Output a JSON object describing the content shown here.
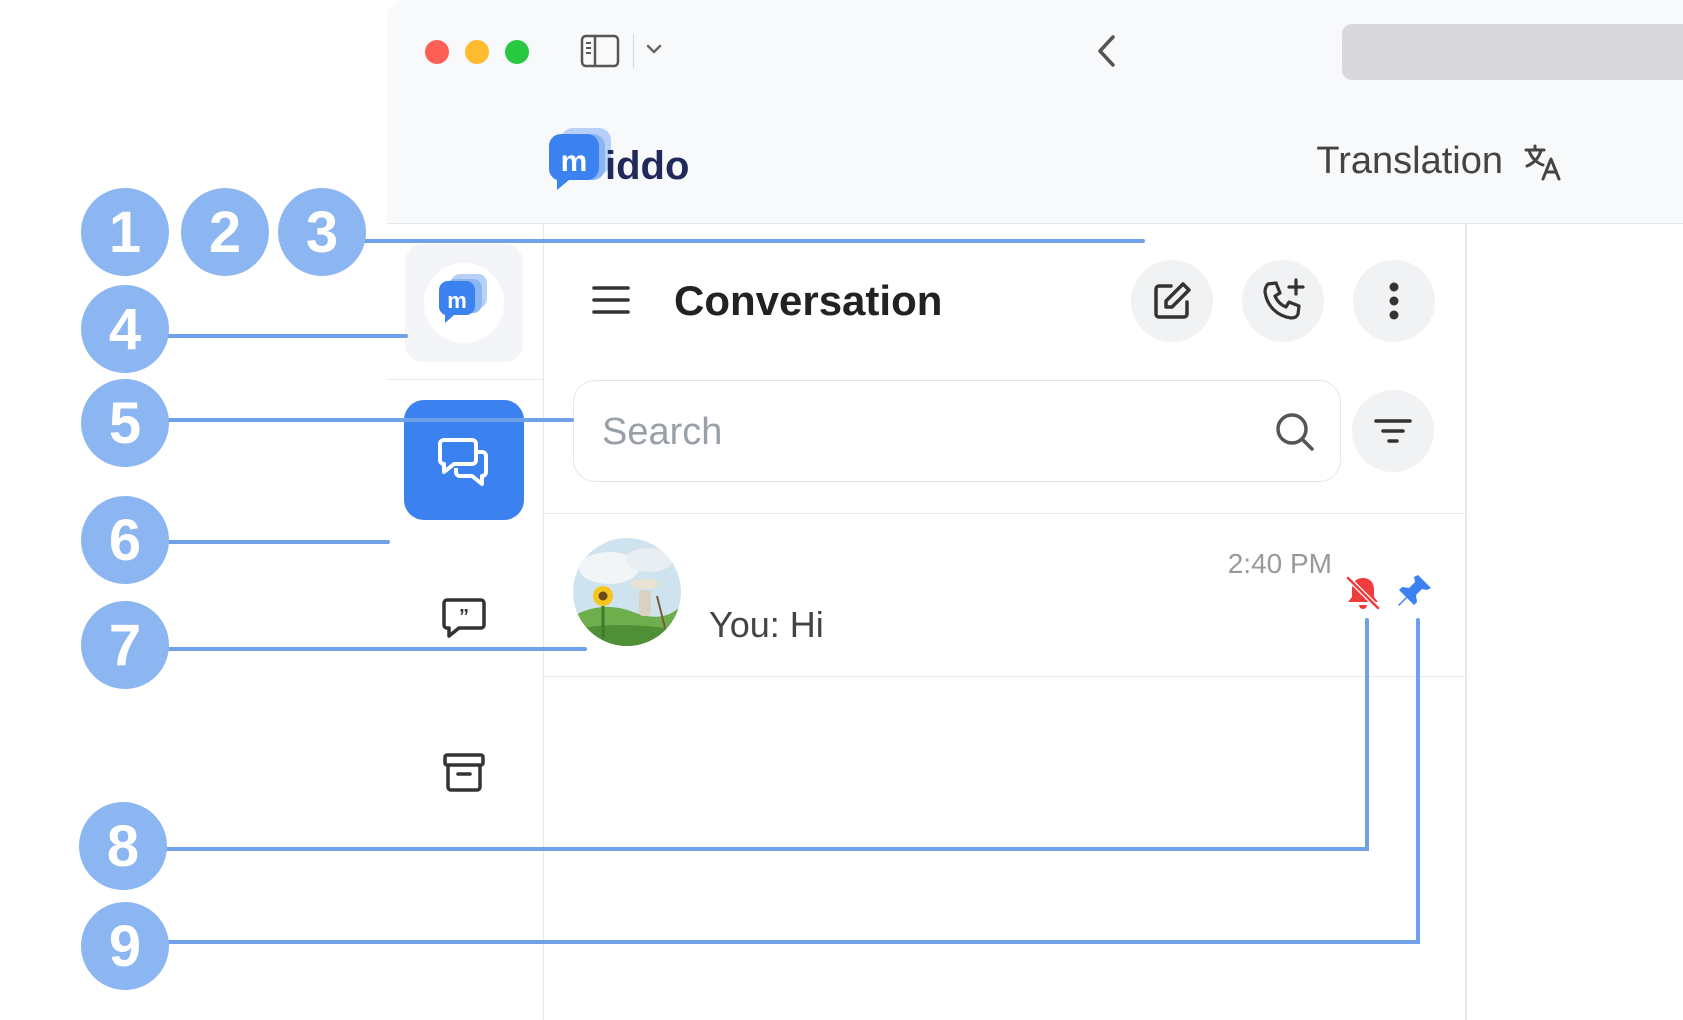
{
  "colors": {
    "accent": "#3b82f0",
    "annotation": "#8cb6f1",
    "annotation_line": "#6fa0e8",
    "mute": "#f03c3c",
    "pin": "#3b82f0"
  },
  "header": {
    "logo_text": "iddo",
    "translation_label": "Translation",
    "translation_icon": "translate-icon"
  },
  "sidebar": {
    "items": [
      {
        "name": "logo",
        "icon": "middo-logo-icon"
      },
      {
        "name": "conversations",
        "icon": "chat-bubbles-icon",
        "active": true
      },
      {
        "name": "discussions",
        "icon": "quote-chat-icon"
      },
      {
        "name": "archive",
        "icon": "archive-box-icon"
      }
    ]
  },
  "panel": {
    "title": "Conversation",
    "actions": [
      "edit-icon",
      "phone-plus-icon",
      "more-vertical-icon"
    ],
    "search": {
      "placeholder": "Search",
      "value": ""
    },
    "filter_icon": "filter-icon"
  },
  "conversations": [
    {
      "time": "2:40 PM",
      "message": "You: Hi",
      "muted": true,
      "pinned": true
    }
  ],
  "annotations": [
    "1",
    "2",
    "3",
    "4",
    "5",
    "6",
    "7",
    "8",
    "9"
  ]
}
